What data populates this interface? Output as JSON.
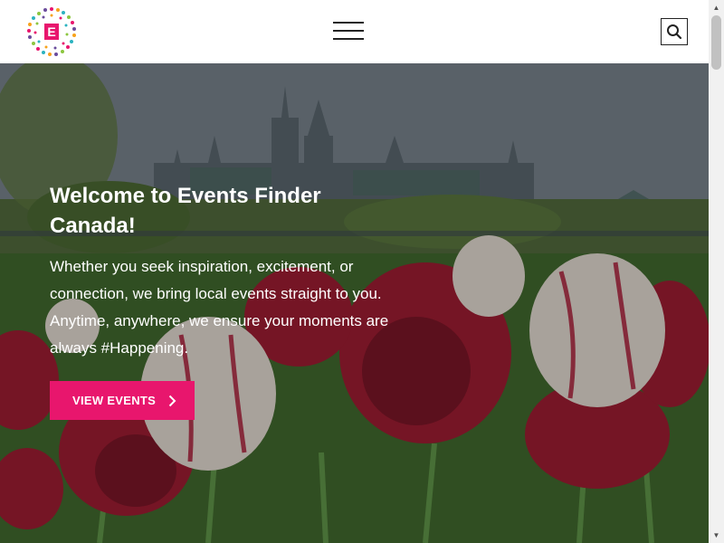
{
  "header": {
    "logo_letter": "E",
    "menu_icon": "hamburger-menu-icon",
    "search_icon": "search-icon"
  },
  "hero": {
    "title": "Welcome to Events Finder Canada!",
    "text": "Whether you seek inspiration, excitement, or connection, we bring local events straight to you. Anytime, anywhere, we ensure your moments are always #Happening.",
    "cta_label": "VIEW EVENTS",
    "cta_icon": "chevron-right-icon"
  },
  "colors": {
    "accent": "#e8166d",
    "header_bg": "#ffffff"
  }
}
